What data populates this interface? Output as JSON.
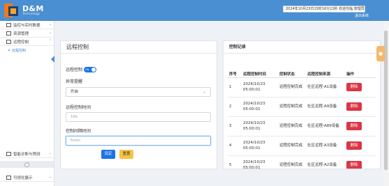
{
  "header": {
    "logo_text": "D&M",
    "logo_subtext": "Technology",
    "info_text": "2024年10月23日15时16分22秒   欢迎光临,管理员",
    "logout_label": "退出系统"
  },
  "sidebar": {
    "items": [
      {
        "label": "监控与实时数据"
      },
      {
        "label": "资源管理"
      },
      {
        "label": "远程控制"
      }
    ],
    "sub_items": [
      {
        "label": "远程控制"
      }
    ],
    "bottom_items": [
      {
        "label": "智能诊断与预测"
      },
      {
        "label": "可视化展示"
      }
    ]
  },
  "left_panel": {
    "title": "远程控制",
    "remote_label": "远程控制",
    "switch_text": "ON",
    "alert_label": "异常提醒",
    "alert_value": "开启",
    "time_label": "远程控制时间",
    "time_placeholder": "10s",
    "interval_label": "控制间隔时间",
    "interval_placeholder": "5min",
    "set_label": "设定",
    "reset_label": "重置"
  },
  "right_panel": {
    "title": "控制记录",
    "columns": [
      "序号",
      "远程控制时间",
      "控制状态",
      "远程控制来源",
      "操作"
    ],
    "rows": [
      {
        "no": "1",
        "time": "2024/10/23 05:00:01",
        "status": "远程控制完成",
        "source": "社区远程-A1设备",
        "action": "删除"
      },
      {
        "no": "2",
        "time": "2024/10/23 05:00:01",
        "status": "远程控制完成",
        "source": "社区远程-A9设备",
        "action": "删除"
      },
      {
        "no": "3",
        "time": "2024/10/23 05:00:01",
        "status": "远程控制完成",
        "source": "社区远程-A89设备",
        "action": "删除"
      },
      {
        "no": "4",
        "time": "2024/10/23 05:00:01",
        "status": "远程控制完成",
        "source": "社区远程-A3设备",
        "action": "删除"
      },
      {
        "no": "5",
        "time": "2024/10/23 05:00:01",
        "status": "远程控制完成",
        "source": "社区远程-A2设备",
        "action": "删除"
      }
    ]
  },
  "colors": {
    "header": "#4a8fd1",
    "primary": "#1a73e8",
    "danger": "#dc3545",
    "warning": "#f6c343"
  }
}
